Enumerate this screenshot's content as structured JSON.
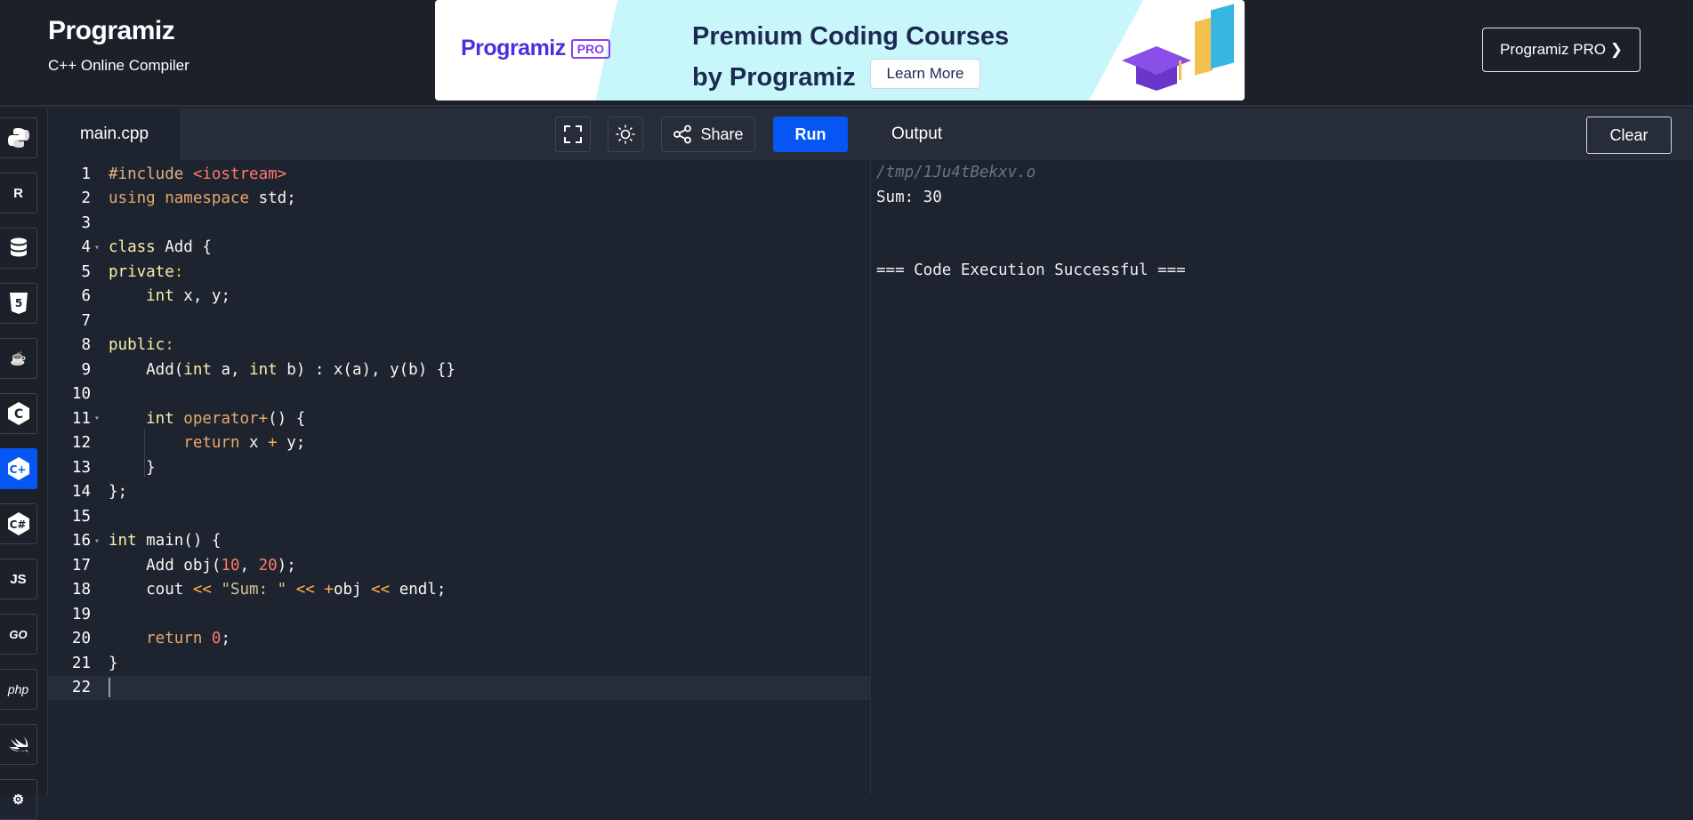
{
  "header": {
    "logo_text": "Programiz",
    "subtitle": "C++ Online Compiler",
    "pro_button": "Programiz PRO ❯"
  },
  "banner": {
    "logo_text": "Programiz",
    "logo_badge": "PRO",
    "headline_line1": "Premium Coding Courses",
    "headline_line2": "by Programiz",
    "cta": "Learn More"
  },
  "rail": {
    "languages": [
      {
        "name": "python",
        "glyph": "◆"
      },
      {
        "name": "r",
        "glyph": "R"
      },
      {
        "name": "sql",
        "glyph": "⛁"
      },
      {
        "name": "html",
        "glyph": "5"
      },
      {
        "name": "java",
        "glyph": "☕"
      },
      {
        "name": "c",
        "glyph": "C"
      },
      {
        "name": "cpp",
        "glyph": "C+"
      },
      {
        "name": "csharp",
        "glyph": "C#"
      },
      {
        "name": "js",
        "glyph": "JS"
      },
      {
        "name": "go",
        "glyph": "GO"
      },
      {
        "name": "php",
        "glyph": "php"
      },
      {
        "name": "swift",
        "glyph": "➤"
      },
      {
        "name": "rust",
        "glyph": "⚙"
      }
    ],
    "active": "cpp"
  },
  "editor": {
    "tab": "main.cpp",
    "share_label": "Share",
    "run_label": "Run",
    "line_numbers": [
      "1",
      "2",
      "3",
      "4",
      "5",
      "6",
      "7",
      "8",
      "9",
      "10",
      "11",
      "12",
      "13",
      "14",
      "15",
      "16",
      "17",
      "18",
      "19",
      "20",
      "21",
      "22"
    ]
  },
  "output": {
    "title": "Output",
    "clear_label": "Clear",
    "path": "/tmp/1Ju4tBekxv.o",
    "line1": "Sum: 30",
    "line2": "=== Code Execution Successful ==="
  },
  "code": {
    "l1a": "#include ",
    "l1b": "<iostream>",
    "l2a": "using namespace",
    "l2b": " std;",
    "l4a": "class",
    "l4b": " Add {",
    "l5a": "private",
    "l5b": ":",
    "l6a": "    int",
    "l6b": " x, y;",
    "l8a": "public",
    "l8b": ":",
    "l9a": "    Add(",
    "l9b": "int",
    "l9c": " a, ",
    "l9d": "int",
    "l9e": " b) : x(a), y(b) {}",
    "l11a": "    int",
    "l11b": " operator+",
    "l11c": "() {",
    "l12a": "        return",
    "l12b": " x ",
    "l12c": "+",
    "l12d": " y;",
    "l13": "    }",
    "l14": "};",
    "l16a": "int",
    "l16b": " main() {",
    "l17a": "    Add obj(",
    "l17b": "10",
    "l17c": ", ",
    "l17d": "20",
    "l17e": ");",
    "l18a": "    cout ",
    "l18b": "<<",
    "l18c": " ",
    "l18d": "\"Sum: \"",
    "l18e": " ",
    "l18f": "<<",
    "l18g": " ",
    "l18h": "+",
    "l18i": "obj ",
    "l18j": "<<",
    "l18k": " endl;",
    "l20a": "    return",
    "l20b": " 0",
    "l20c": ";",
    "l21": "}"
  }
}
